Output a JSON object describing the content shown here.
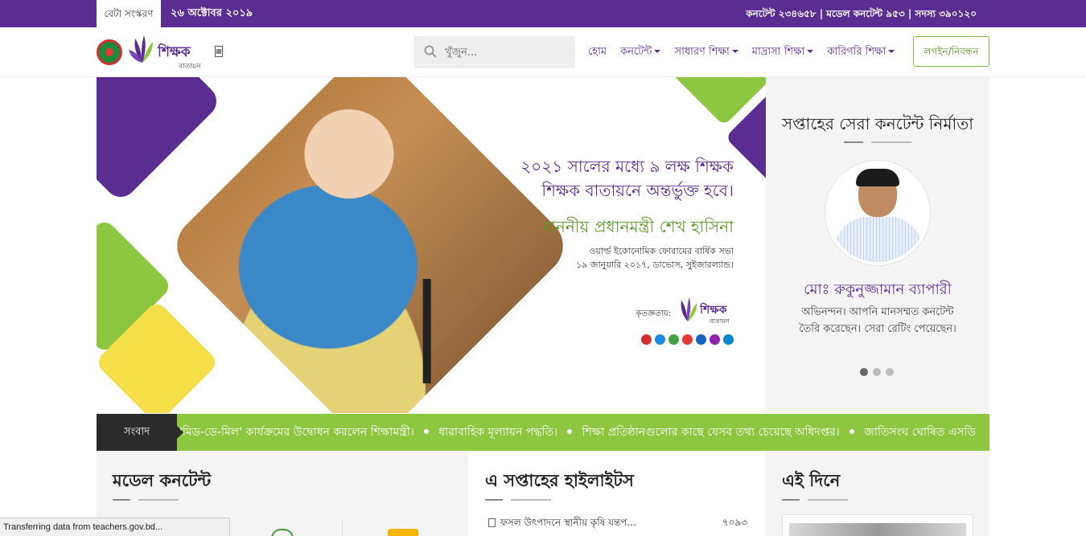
{
  "topbar": {
    "beta_label": "বেটা সংস্করণ",
    "date": "২৬ অক্টোবর ২০১৯",
    "stats": "কনটেন্ট ২৩৪৬৫৮ | মডেল কনটেন্ট ৯৫৩ | সদস্য ৩৯০১২০"
  },
  "header": {
    "logo_text": "শিক্ষক",
    "logo_sub": "বাতায়ন",
    "search_placeholder": "খুঁজুন...",
    "nav": [
      {
        "label": "হোম",
        "dropdown": false
      },
      {
        "label": "কনটেন্ট",
        "dropdown": true
      },
      {
        "label": "সাধারণ শিক্ষা",
        "dropdown": true
      },
      {
        "label": "মাদ্রাসা শিক্ষা",
        "dropdown": true
      },
      {
        "label": "কারিগরি শিক্ষা",
        "dropdown": true
      }
    ],
    "login_label": "লগইন/নিবন্ধন"
  },
  "banner": {
    "line1": "২০২১ সালের মধ্যে ৯ লক্ষ শিক্ষক",
    "line2": "শিক্ষক বাতায়নে অন্তর্ভুক্ত হবে।",
    "quote_by": "মাননীয় প্রধানমন্ত্রী শেখ হাসিনা",
    "event": "ওয়ার্ল্ড ইকোনোমিক ফোরামের বার্ষিক সভা",
    "event_date": "১৯ জানুয়ারি ২০১৭, ডাভোস, সুইজারল্যান্ড।",
    "credit_label": "কৃতজ্ঞতায়:",
    "credit_logo": "শিক্ষক",
    "credit_logo_sub": "বাতায়ন"
  },
  "creator": {
    "title": "সপ্তাহের সেরা কনটেন্ট নির্মাতা",
    "name": "মোঃ রুকুনুজ্জামান ব্যাপারী",
    "description": "অভিনন্দন। আপনি মানসম্মত কনটেন্ট তৈরি করেছেন। সেরা রেটিং পেয়েছেন।",
    "active_slide": 1,
    "slides": 3
  },
  "ticker": {
    "label": "সংবাদ",
    "items": [
      "'মিড-ডে-মিল' কার্যক্রমের উদ্বোধন করলেন শিক্ষামন্ত্রী।",
      "ধারাবাহিক মূল্যায়ন পদ্ধতি।",
      "শিক্ষা প্রতিষ্ঠানগুলোর কাছে যেসব তথ্য চেয়েছে অধিদপ্তর।",
      "জাতিসংঘ ঘোষিত এসডি"
    ]
  },
  "sections": {
    "model": {
      "title": "মডেল কনটেন্ট"
    },
    "highlights": {
      "title": "এ সপ্তাহের হাইলাইটস",
      "rows": [
        {
          "title": "ফসল উৎপাদনে স্থানীয় কৃষি যন্তপ...",
          "count": "৭০৯৩"
        }
      ]
    },
    "today": {
      "title": "এই দিনে"
    }
  },
  "status_bar": "Transferring data from teachers.gov.bd..."
}
